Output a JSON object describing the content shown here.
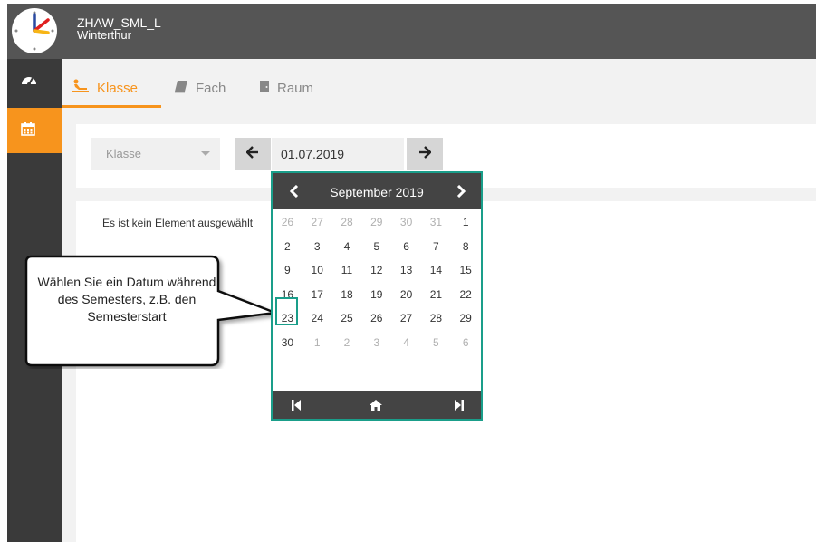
{
  "header": {
    "org_name": "ZHAW_SML_L",
    "org_city": "Winterthur"
  },
  "sidebar": {
    "items": [
      {
        "icon": "dashboard-icon",
        "active": false
      },
      {
        "icon": "calendar-icon",
        "active": true
      }
    ]
  },
  "tabs": [
    {
      "label": "Klasse",
      "icon": "class-icon",
      "active": true
    },
    {
      "label": "Fach",
      "icon": "book-icon",
      "active": false
    },
    {
      "label": "Raum",
      "icon": "door-icon",
      "active": false
    }
  ],
  "filter": {
    "select_placeholder": "Klasse",
    "date_value": "01.07.2019"
  },
  "message": {
    "empty": "Es ist kein Element ausgewählt"
  },
  "callout": {
    "text": "Wählen Sie ein Datum während des Semesters, z.B. den Semesterstart"
  },
  "datepicker": {
    "month_label": "September 2019",
    "weeks": [
      [
        {
          "d": "26",
          "m": true
        },
        {
          "d": "27",
          "m": true
        },
        {
          "d": "28",
          "m": true
        },
        {
          "d": "29",
          "m": true
        },
        {
          "d": "30",
          "m": true
        },
        {
          "d": "31",
          "m": true
        },
        {
          "d": "1",
          "m": false
        }
      ],
      [
        {
          "d": "2",
          "m": false
        },
        {
          "d": "3",
          "m": false
        },
        {
          "d": "4",
          "m": false
        },
        {
          "d": "5",
          "m": false
        },
        {
          "d": "6",
          "m": false
        },
        {
          "d": "7",
          "m": false
        },
        {
          "d": "8",
          "m": false
        }
      ],
      [
        {
          "d": "9",
          "m": false
        },
        {
          "d": "10",
          "m": false
        },
        {
          "d": "11",
          "m": false
        },
        {
          "d": "12",
          "m": false
        },
        {
          "d": "13",
          "m": false
        },
        {
          "d": "14",
          "m": false
        },
        {
          "d": "15",
          "m": false
        }
      ],
      [
        {
          "d": "16",
          "m": false,
          "highlight": true
        },
        {
          "d": "17",
          "m": false
        },
        {
          "d": "18",
          "m": false
        },
        {
          "d": "19",
          "m": false
        },
        {
          "d": "20",
          "m": false
        },
        {
          "d": "21",
          "m": false
        },
        {
          "d": "22",
          "m": false
        }
      ],
      [
        {
          "d": "23",
          "m": false
        },
        {
          "d": "24",
          "m": false
        },
        {
          "d": "25",
          "m": false
        },
        {
          "d": "26",
          "m": false
        },
        {
          "d": "27",
          "m": false
        },
        {
          "d": "28",
          "m": false
        },
        {
          "d": "29",
          "m": false
        }
      ],
      [
        {
          "d": "30",
          "m": false
        },
        {
          "d": "1",
          "m": true
        },
        {
          "d": "2",
          "m": true
        },
        {
          "d": "3",
          "m": true
        },
        {
          "d": "4",
          "m": true
        },
        {
          "d": "5",
          "m": true
        },
        {
          "d": "6",
          "m": true
        }
      ]
    ]
  },
  "colors": {
    "accent": "#f7941d",
    "highlight": "#1a9e8a",
    "header_bg": "#555555",
    "sidebar_bg": "#3a3a3a"
  }
}
